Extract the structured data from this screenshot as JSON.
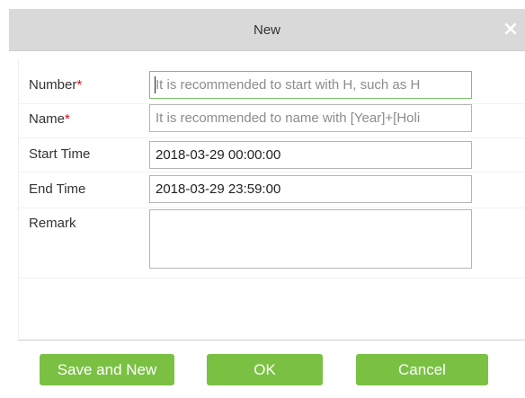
{
  "dialog": {
    "title": "New",
    "close_icon": "close-icon",
    "close_glyph": "×"
  },
  "form": {
    "required_marker": "*",
    "number": {
      "label": "Number",
      "required": true,
      "placeholder": "It is recommended to start with H, such as H",
      "value": ""
    },
    "name": {
      "label": "Name",
      "required": true,
      "placeholder": "It is recommended to name with [Year]+[Holi",
      "value": ""
    },
    "start_time": {
      "label": "Start Time",
      "value": "2018-03-29 00:00:00"
    },
    "end_time": {
      "label": "End Time",
      "value": "2018-03-29 23:59:00"
    },
    "remark": {
      "label": "Remark",
      "value": ""
    }
  },
  "buttons": {
    "save_and_new": "Save and New",
    "ok": "OK",
    "cancel": "Cancel"
  },
  "colors": {
    "titlebar_bg": "#d9d9d9",
    "button_bg": "#7ac143",
    "required_red": "#e60012",
    "focus_border": "#7cc36b"
  }
}
